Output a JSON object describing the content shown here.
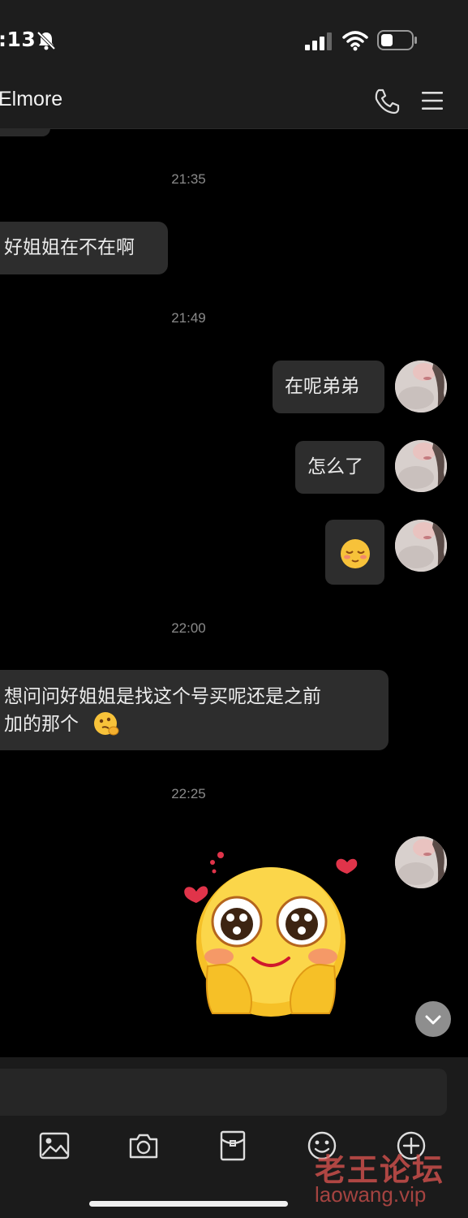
{
  "status_bar": {
    "time": ":13"
  },
  "header": {
    "contact_name": "Elmore"
  },
  "messages": {
    "ts1": "21:35",
    "m1": "好姐姐在不在啊",
    "ts2": "21:49",
    "m2": "在呢弟弟",
    "m3": "怎么了",
    "ts3": "22:00",
    "m4_line1": "想问问好姐姐是找这个号买呢还是之前",
    "m4_line2": "加的那个",
    "ts4": "22:25"
  },
  "icons": {
    "status": [
      "silent-bell-icon",
      "signal-icon",
      "wifi-icon",
      "battery-icon"
    ],
    "header": [
      "phone-icon",
      "menu-icon"
    ],
    "toolbar": [
      "image-icon",
      "camera-icon",
      "red-packet-icon",
      "emoji-icon",
      "plus-icon"
    ]
  },
  "watermark": {
    "line1": "老王论坛",
    "line2": "laowang.vip"
  }
}
